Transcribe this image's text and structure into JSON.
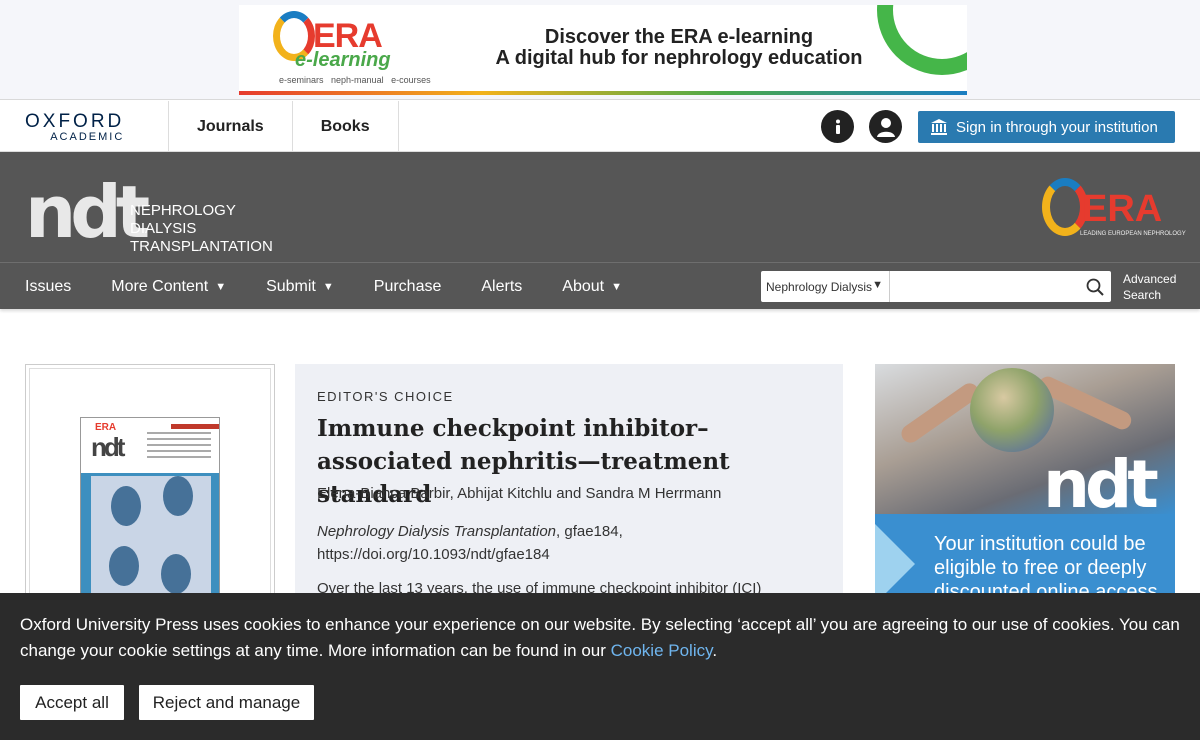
{
  "ad_banner": {
    "logo_word": "ERA",
    "logo_sub": "e-learning",
    "logo_links": [
      "e-seminars",
      "neph-manual",
      "e-courses"
    ],
    "headline_1": "Discover the ERA e-learning",
    "headline_2": "A digital hub for nephrology education"
  },
  "topbar": {
    "brand_line1": "OXFORD",
    "brand_line2": "ACADEMIC",
    "nav": [
      "Journals",
      "Books"
    ],
    "info_icon": "info-icon",
    "account_icon": "user-icon",
    "signin_label": "Sign in through your institution"
  },
  "journal": {
    "logo_word": "ndt",
    "title_lines": [
      "NEPHROLOGY",
      "DIALYSIS",
      "TRANSPLANTATION"
    ],
    "partner_word": "ERA",
    "partner_tagline": "LEADING EUROPEAN NEPHROLOGY"
  },
  "journal_nav": {
    "items": [
      {
        "label": "Issues",
        "dropdown": false
      },
      {
        "label": "More Content",
        "dropdown": true
      },
      {
        "label": "Submit",
        "dropdown": true
      },
      {
        "label": "Purchase",
        "dropdown": false
      },
      {
        "label": "Alerts",
        "dropdown": false
      },
      {
        "label": "About",
        "dropdown": true
      }
    ],
    "search_scope": "Nephrology Dialysis",
    "search_placeholder": "",
    "advanced_search_1": "Advanced",
    "advanced_search_2": "Search"
  },
  "article": {
    "eyebrow": "EDITOR'S CHOICE",
    "title": "Immune checkpoint inhibitor–associated nephritis—treatment standard",
    "authors": "Elena-Bianca Barbir, Abhijat Kitchlu and Sandra M Herrmann",
    "journal_name": "Nephrology Dialysis Transplantation",
    "article_id": ", gfae184,",
    "doi": "https://doi.org/10.1093/ndt/gfae184",
    "abstract_start": "Over the last 13 years, the use of immune checkpoint inhibitor (ICI)"
  },
  "side_ad": {
    "logo_word": "ndt",
    "copy": "Your institution could be eligible to free or deeply discounted online access"
  },
  "cookie": {
    "message": "Oxford University Press uses cookies to enhance your experience on our website. By selecting ‘accept all’ you are agreeing to our use of cookies. You can change your cookie settings at any time. More information can be found in our ",
    "link": "Cookie Policy",
    "period": ".",
    "accept_label": "Accept all",
    "reject_label": "Reject and manage"
  },
  "colors": {
    "header_gray": "#565656",
    "signin_blue": "#2a7ab0",
    "cookie_bg": "#2b2b2b",
    "cookie_link": "#6fb5ee",
    "card_bg": "#eef0f5",
    "era_red": "#e63b2e"
  }
}
